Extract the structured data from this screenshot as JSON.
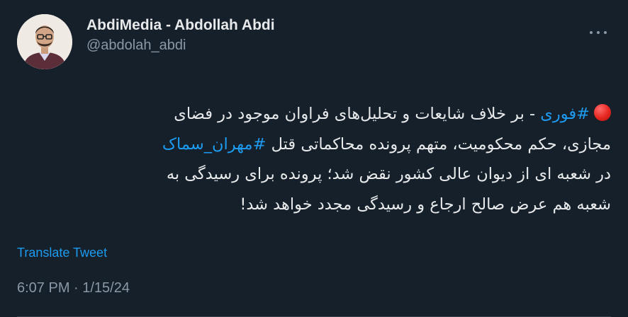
{
  "author": {
    "display_name": "AbdiMedia - Abdollah Abdi",
    "handle": "@abdolah_abdi",
    "avatar_icon": "profile-photo"
  },
  "tweet": {
    "emoji": "red-circle",
    "hashtag_1": "#فوری",
    "line_1_rest": " - بر خلاف شایعات و تحلیل‌های فراوان موجود در فضای",
    "line_2_text": "مجازی، حکم  محکومیت، متهم پرونده محاکماتی  قتل ",
    "hashtag_2": "#مهران_سماک",
    "line_3": "در شعبه ای از  دیوان عالی کشور نقض شد؛ پرونده برای رسیدگی به",
    "line_4": "شعبه هم عرض صالح ارجاع و رسیدگی مجدد خواهد شد!"
  },
  "translate_label": "Translate Tweet",
  "timestamp": "6:07 PM · 1/15/24",
  "colors": {
    "background": "#15202b",
    "accent": "#1d9bf0",
    "text": "#e7e9ea",
    "muted": "#8b98a5"
  }
}
